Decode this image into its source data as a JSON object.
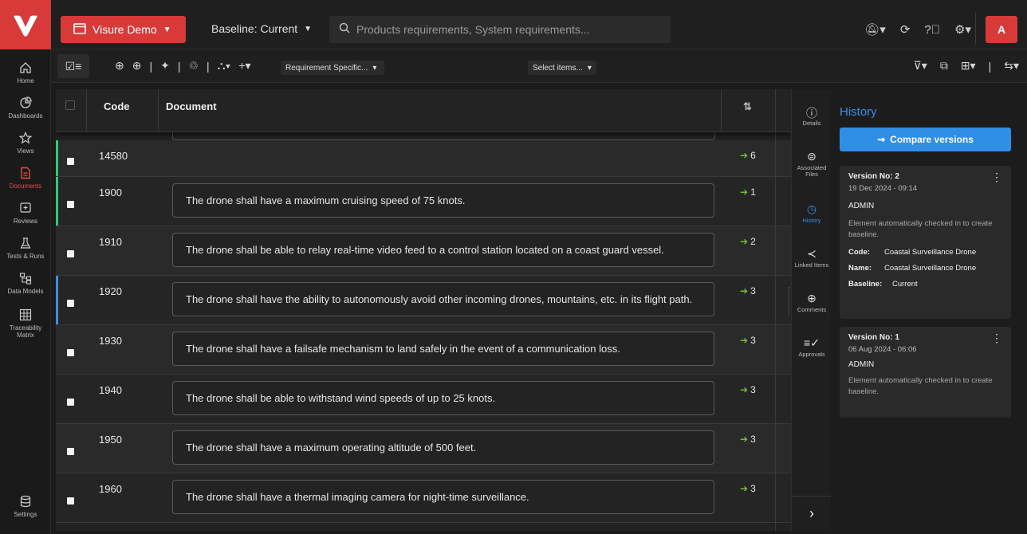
{
  "nav": {
    "items": [
      {
        "label": "Home",
        "icon": "home-icon"
      },
      {
        "label": "Dashboards",
        "icon": "dashboards-icon"
      },
      {
        "label": "Views",
        "icon": "views-icon"
      },
      {
        "label": "Documents",
        "icon": "documents-icon"
      },
      {
        "label": "Reviews",
        "icon": "reviews-icon"
      },
      {
        "label": "Tests & Runs",
        "icon": "tests-icon"
      },
      {
        "label": "Data Models",
        "icon": "data-models-icon"
      },
      {
        "label": "Traceability Matrix",
        "icon": "traceability-icon"
      }
    ],
    "settings": "Settings"
  },
  "header": {
    "project": "Visure Demo",
    "baseline": "Baseline: Current",
    "search_placeholder": "Products requirements, System requirements...",
    "avatar": "A"
  },
  "toolbar": {
    "spec_dropdown": "Requirement Specific...",
    "select_dropdown": "Select items..."
  },
  "table": {
    "columns": {
      "code": "Code",
      "document": "Document"
    },
    "rows": [
      {
        "code": "14580",
        "text": "",
        "links": "6",
        "bar": "#2ecc71"
      },
      {
        "code": "1900",
        "text": "The drone shall have a maximum cruising speed of 75 knots.",
        "links": "1",
        "bar": "#2ecc71"
      },
      {
        "code": "1910",
        "text": "The drone shall be able to relay real-time video feed to a control station located on a coast guard vessel.",
        "links": "2",
        "bar": ""
      },
      {
        "code": "1920",
        "text": "The drone shall have the ability to autonomously avoid other incoming drones, mountains, etc. in its flight path.",
        "links": "3",
        "bar": "#3a8ee6"
      },
      {
        "code": "1930",
        "text": "The drone shall have a failsafe mechanism to land safely in the event of a communication loss.",
        "links": "3",
        "bar": ""
      },
      {
        "code": "1940",
        "text": "The drone shall be able to withstand wind speeds of up to 25 knots.",
        "links": "3",
        "bar": ""
      },
      {
        "code": "1950",
        "text": "The drone shall have a maximum operating altitude of 500 feet.",
        "links": "3",
        "bar": ""
      },
      {
        "code": "1960",
        "text": "The drone shall have a thermal imaging camera for night-time surveillance.",
        "links": "3",
        "bar": ""
      }
    ]
  },
  "sidetabs": [
    {
      "label": "Details",
      "icon": "info-icon"
    },
    {
      "label": "Associated Files",
      "icon": "paperclip-icon"
    },
    {
      "label": "History",
      "icon": "clock-icon"
    },
    {
      "label": "Linked Items",
      "icon": "share-icon"
    },
    {
      "label": "Comments",
      "icon": "comment-icon"
    },
    {
      "label": "Approvals",
      "icon": "approvals-icon"
    }
  ],
  "history": {
    "title": "History",
    "compare_label": "Compare versions",
    "versions": [
      {
        "version": "Version No: 2",
        "date": "19 Dec 2024 - 09:14",
        "user": "ADMIN",
        "message": "Element automatically checked in to create baseline.",
        "code_label": "Code:",
        "code": "Coastal Surveillance Drone",
        "name_label": "Name:",
        "name": "Coastal Surveillance Drone",
        "baseline_label": "Baseline:",
        "baseline": "Current"
      },
      {
        "version": "Version No: 1",
        "date": "06 Aug 2024 - 06:06",
        "user": "ADMIN",
        "message": "Element automatically checked in to create baseline."
      }
    ]
  },
  "colors": {
    "brand": "#d83a3a",
    "accent": "#3a8ee6",
    "link_arrow": "#6fbf3c"
  }
}
